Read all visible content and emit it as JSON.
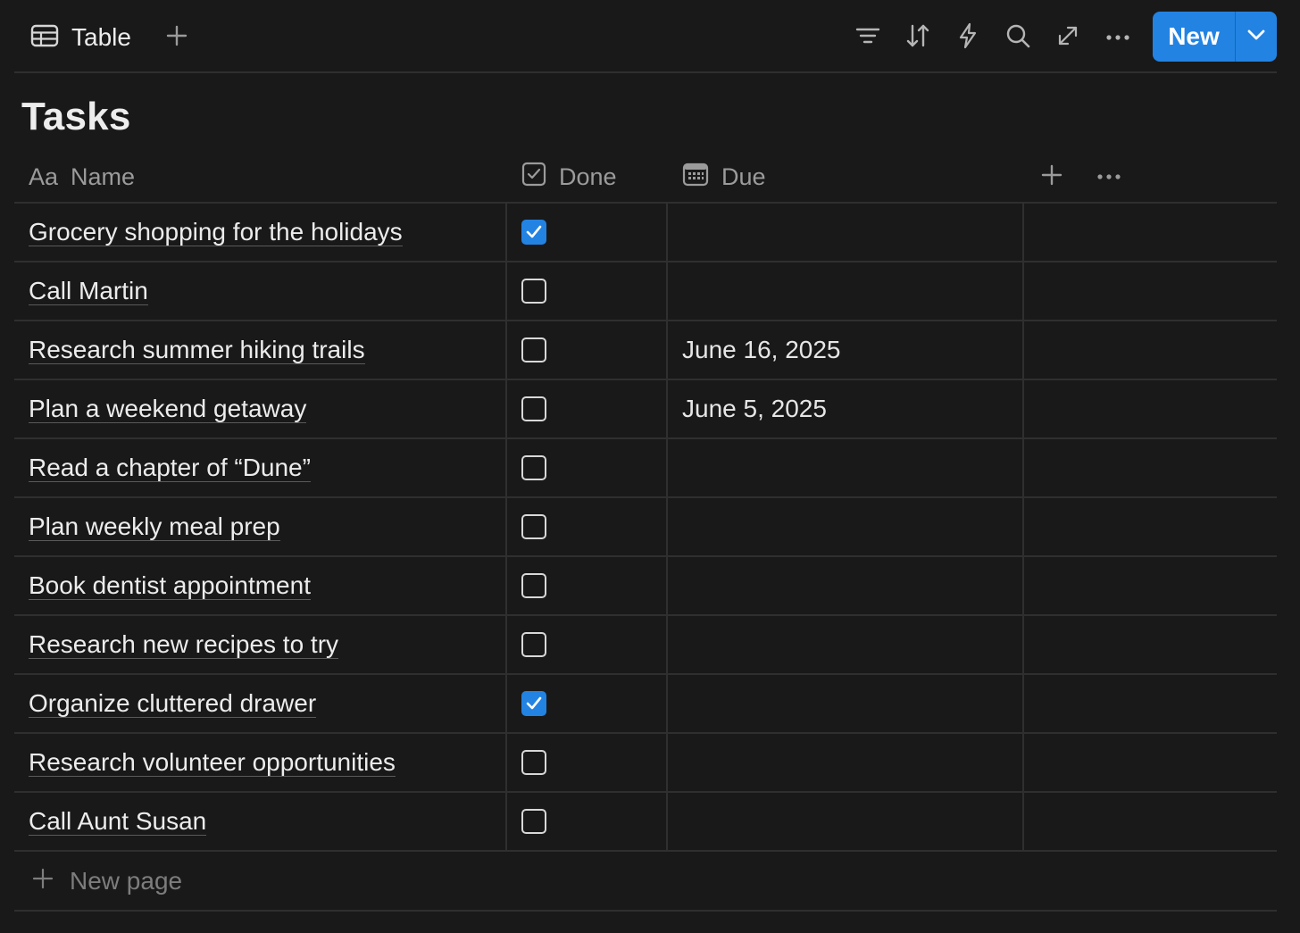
{
  "toolbar": {
    "view_label": "Table",
    "new_button_label": "New",
    "icons": [
      "table-icon",
      "add-view-icon",
      "filter-icon",
      "sort-icon",
      "automation-icon",
      "search-icon",
      "expand-icon",
      "more-icon",
      "chevron-down-icon"
    ]
  },
  "title": "Tasks",
  "columns": {
    "name": {
      "icon_glyph": "Aa",
      "label": "Name"
    },
    "done": {
      "label": "Done",
      "icon": "checkbox-property-icon"
    },
    "due": {
      "label": "Due",
      "icon": "calendar-icon"
    }
  },
  "rows": [
    {
      "name": "Grocery shopping for the holidays",
      "done": true,
      "due": ""
    },
    {
      "name": "Call Martin",
      "done": false,
      "due": ""
    },
    {
      "name": "Research summer hiking trails",
      "done": false,
      "due": "June 16, 2025"
    },
    {
      "name": "Plan a weekend getaway",
      "done": false,
      "due": "June 5, 2025"
    },
    {
      "name": "Read a chapter of “Dune”",
      "done": false,
      "due": ""
    },
    {
      "name": "Plan weekly meal prep",
      "done": false,
      "due": ""
    },
    {
      "name": "Book dentist appointment",
      "done": false,
      "due": ""
    },
    {
      "name": "Research new recipes to try",
      "done": false,
      "due": ""
    },
    {
      "name": "Organize cluttered drawer",
      "done": true,
      "due": ""
    },
    {
      "name": "Research volunteer opportunities",
      "done": false,
      "due": ""
    },
    {
      "name": "Call Aunt Susan",
      "done": false,
      "due": ""
    }
  ],
  "new_page_label": "New page",
  "colors": {
    "background": "#191919",
    "accent": "#2383e2",
    "divider": "#2f2f2f",
    "muted_text": "#9b9b9b"
  }
}
